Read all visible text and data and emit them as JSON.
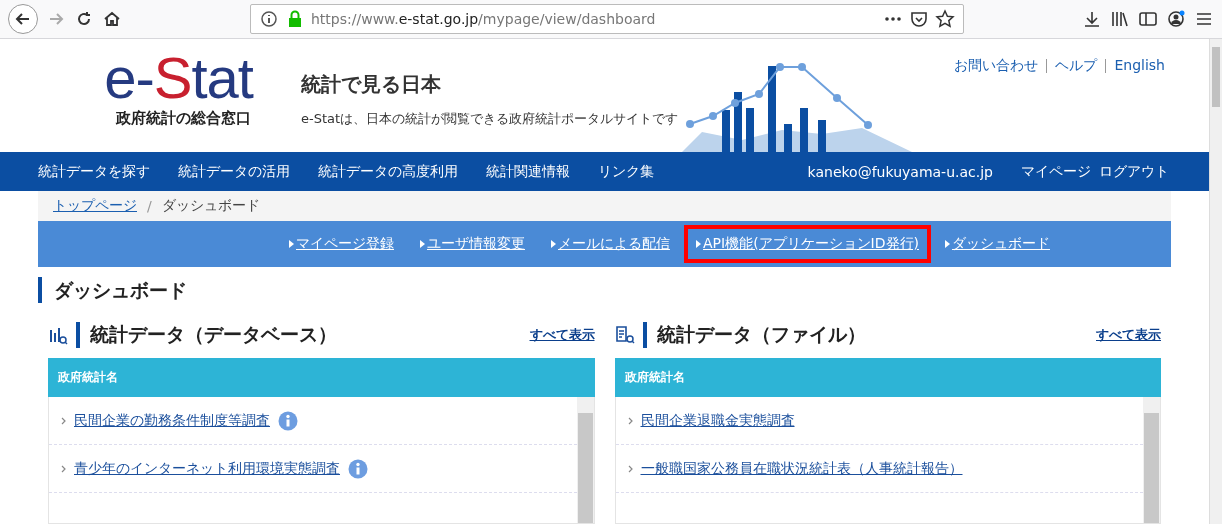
{
  "browser": {
    "url_host": "https://www.e-stat.go.jp",
    "url_path": "/mypage/view/dashboard"
  },
  "header": {
    "logo_main": "e-",
    "logo_accent": "S",
    "logo_rest": "tat",
    "logo_sub": "政府統計の総合窓口",
    "title": "統計で見る日本",
    "tagline": "e-Statは、日本の統計が閲覧できる政府統計ポータルサイトです",
    "links": [
      "お問い合わせ",
      "ヘルプ",
      "English"
    ]
  },
  "nav": {
    "items": [
      "統計データを探す",
      "統計データの活用",
      "統計データの高度利用",
      "統計関連情報",
      "リンク集"
    ],
    "user": "kaneko@fukuyama-u.ac.jp",
    "right": [
      "マイページ",
      "ログアウト"
    ]
  },
  "breadcrumb_separator": "/",
  "breadcrumb": [
    {
      "label": "トップページ",
      "link": true
    },
    {
      "label": "ダッシュボード",
      "link": false
    }
  ],
  "subnav": [
    {
      "label": "マイページ登録",
      "highlighted": false
    },
    {
      "label": "ユーザ情報変更",
      "highlighted": false
    },
    {
      "label": "メールによる配信",
      "highlighted": false
    },
    {
      "label": "API機能(アプリケーションID発行)",
      "highlighted": true
    },
    {
      "label": "ダッシュボード",
      "highlighted": false
    }
  ],
  "page_title": "ダッシュボード",
  "panels": [
    {
      "kind": "database",
      "title": "統計データ（データベース）",
      "show_all": "すべて表示",
      "column": "政府統計名",
      "rows": [
        {
          "label": "民間企業の勤務条件制度等調査",
          "info": true
        },
        {
          "label": "青少年のインターネット利用環境実態調査",
          "info": true
        }
      ]
    },
    {
      "kind": "file",
      "title": "統計データ（ファイル）",
      "show_all": "すべて表示",
      "column": "政府統計名",
      "rows": [
        {
          "label": "民間企業退職金実態調査",
          "info": false
        },
        {
          "label": "一般職国家公務員在職状況統計表（人事統計報告）",
          "info": false
        }
      ]
    }
  ]
}
